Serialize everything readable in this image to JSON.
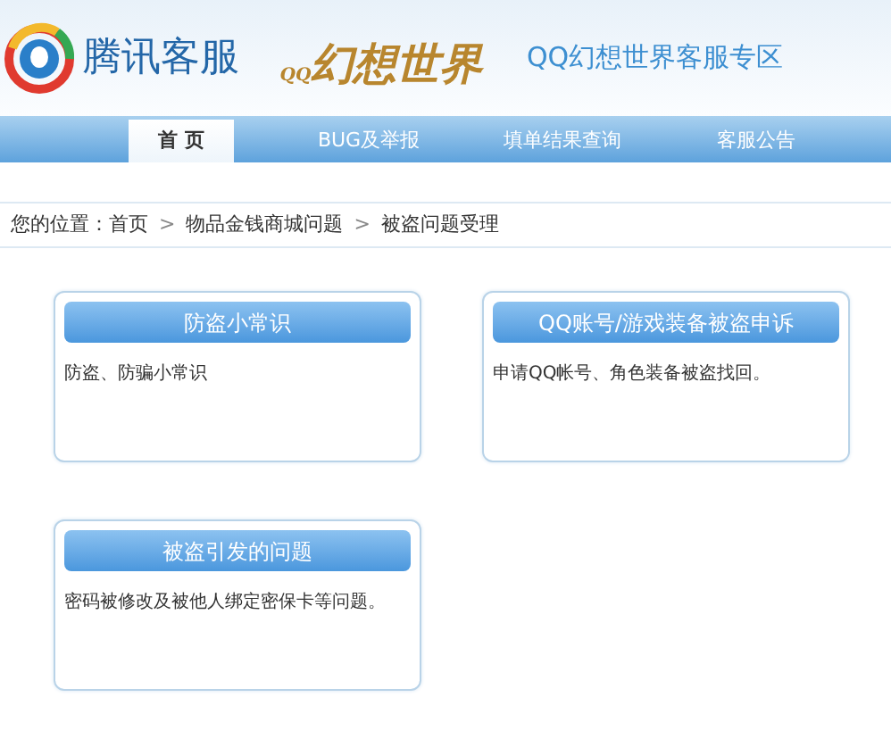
{
  "header": {
    "brand": "腾讯客服",
    "game_logo": {
      "small": "QQ",
      "main": "幻想世界"
    },
    "zone_title": "QQ幻想世界客服专区"
  },
  "nav": [
    {
      "label": "首 页",
      "selected": true
    },
    {
      "label": "BUG及举报",
      "selected": false
    },
    {
      "label": "填单结果查询",
      "selected": false
    },
    {
      "label": "客服公告",
      "selected": false
    }
  ],
  "breadcrumb": {
    "prefix": "您的位置：",
    "separator": ">",
    "items": [
      "首页",
      "物品金钱商城问题",
      "被盗问题受理"
    ]
  },
  "cards": [
    {
      "title": "防盗小常识",
      "text": "防盗、防骗小常识"
    },
    {
      "title": "QQ账号/游戏装备被盗申诉",
      "text": "申请QQ帐号、角色装备被盗找回。"
    },
    {
      "title": "被盗引发的问题",
      "text": "密码被修改及被他人绑定密保卡等问题。"
    }
  ]
}
